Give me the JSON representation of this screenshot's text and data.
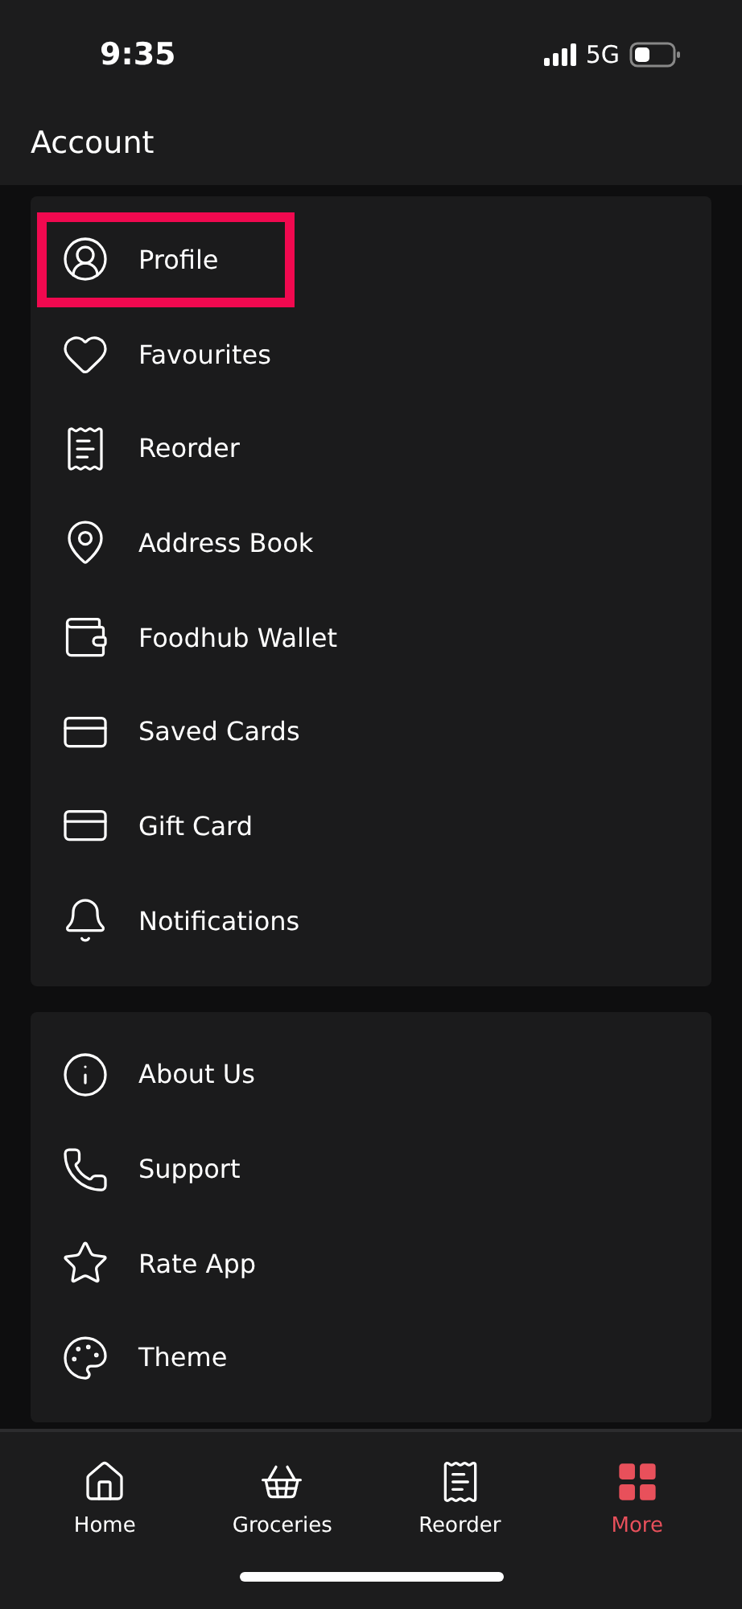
{
  "status_bar": {
    "time": "9:35",
    "network": "5G"
  },
  "header": {
    "title": "Account"
  },
  "sections": [
    {
      "items": [
        {
          "label": "Profile",
          "highlighted": true
        },
        {
          "label": "Favourites",
          "highlighted": false
        },
        {
          "label": "Reorder",
          "highlighted": false
        },
        {
          "label": "Address Book",
          "highlighted": false
        },
        {
          "label": "Foodhub Wallet",
          "highlighted": false
        },
        {
          "label": "Saved Cards",
          "highlighted": false
        },
        {
          "label": "Gift Card",
          "highlighted": false
        },
        {
          "label": "Notifications",
          "highlighted": false
        }
      ]
    },
    {
      "items": [
        {
          "label": "About Us",
          "highlighted": false
        },
        {
          "label": "Support",
          "highlighted": false
        },
        {
          "label": "Rate App",
          "highlighted": false
        },
        {
          "label": "Theme",
          "highlighted": false
        }
      ]
    }
  ],
  "tab_bar": [
    {
      "label": "Home",
      "selected": false
    },
    {
      "label": "Groceries",
      "selected": false
    },
    {
      "label": "Reorder",
      "selected": false
    },
    {
      "label": "More",
      "selected": true
    }
  ]
}
